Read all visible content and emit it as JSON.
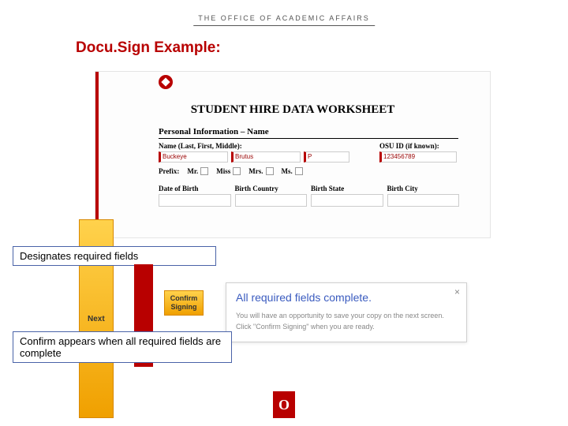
{
  "header": {
    "office": "THE OFFICE OF ACADEMIC AFFAIRS"
  },
  "title": "Docu.Sign Example:",
  "worksheet": {
    "heading": "STUDENT HIRE DATA WORKSHEET",
    "section_label": "Personal Information – Name",
    "name_label": "Name (Last, First, Middle):",
    "osu_label": "OSU ID (if known):",
    "fields": {
      "last": "Buckeye",
      "first": "Brutus",
      "middle": "P",
      "osu_id": "123456789"
    },
    "prefix_label": "Prefix:",
    "prefixes": [
      "Mr.",
      "Miss",
      "Mrs.",
      "Ms."
    ],
    "dob_label": "Date of Birth",
    "birth_country_label": "Birth Country",
    "birth_state_label": "Birth State",
    "birth_city_label": "Birth City",
    "next_label": "Next"
  },
  "callouts": {
    "required": "Designates required fields",
    "confirm_note": "Confirm appears when all required fields are complete"
  },
  "confirm_button": "Confirm Signing",
  "popup": {
    "close": "×",
    "title": "All required fields complete.",
    "line1": "You will have an opportunity to save your copy on the next screen.",
    "line2": "Click \"Confirm Signing\" when you are ready."
  },
  "footer_logo_text": "O"
}
